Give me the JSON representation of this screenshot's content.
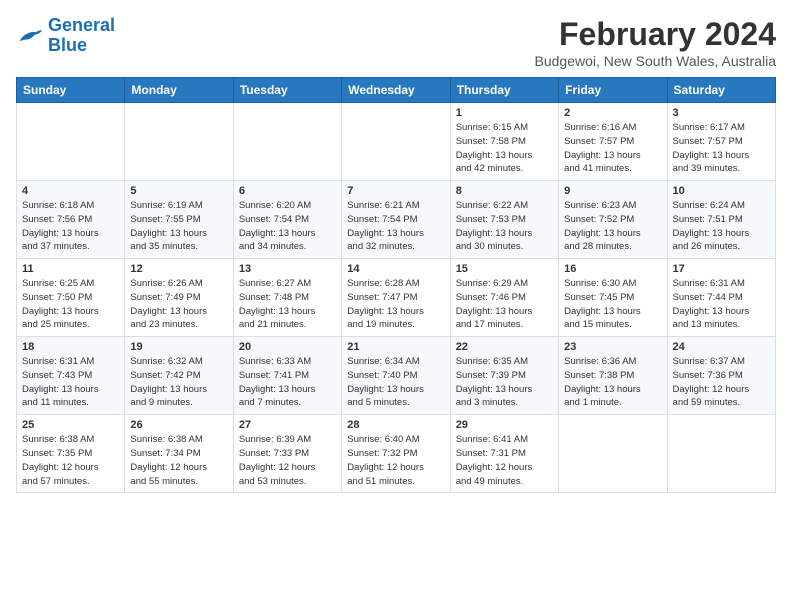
{
  "app": {
    "name_part1": "General",
    "name_part2": "Blue"
  },
  "title": "February 2024",
  "subtitle": "Budgewoi, New South Wales, Australia",
  "headers": [
    "Sunday",
    "Monday",
    "Tuesday",
    "Wednesday",
    "Thursday",
    "Friday",
    "Saturday"
  ],
  "weeks": [
    [
      {
        "day": "",
        "info": ""
      },
      {
        "day": "",
        "info": ""
      },
      {
        "day": "",
        "info": ""
      },
      {
        "day": "",
        "info": ""
      },
      {
        "day": "1",
        "info": "Sunrise: 6:15 AM\nSunset: 7:58 PM\nDaylight: 13 hours\nand 42 minutes."
      },
      {
        "day": "2",
        "info": "Sunrise: 6:16 AM\nSunset: 7:57 PM\nDaylight: 13 hours\nand 41 minutes."
      },
      {
        "day": "3",
        "info": "Sunrise: 6:17 AM\nSunset: 7:57 PM\nDaylight: 13 hours\nand 39 minutes."
      }
    ],
    [
      {
        "day": "4",
        "info": "Sunrise: 6:18 AM\nSunset: 7:56 PM\nDaylight: 13 hours\nand 37 minutes."
      },
      {
        "day": "5",
        "info": "Sunrise: 6:19 AM\nSunset: 7:55 PM\nDaylight: 13 hours\nand 35 minutes."
      },
      {
        "day": "6",
        "info": "Sunrise: 6:20 AM\nSunset: 7:54 PM\nDaylight: 13 hours\nand 34 minutes."
      },
      {
        "day": "7",
        "info": "Sunrise: 6:21 AM\nSunset: 7:54 PM\nDaylight: 13 hours\nand 32 minutes."
      },
      {
        "day": "8",
        "info": "Sunrise: 6:22 AM\nSunset: 7:53 PM\nDaylight: 13 hours\nand 30 minutes."
      },
      {
        "day": "9",
        "info": "Sunrise: 6:23 AM\nSunset: 7:52 PM\nDaylight: 13 hours\nand 28 minutes."
      },
      {
        "day": "10",
        "info": "Sunrise: 6:24 AM\nSunset: 7:51 PM\nDaylight: 13 hours\nand 26 minutes."
      }
    ],
    [
      {
        "day": "11",
        "info": "Sunrise: 6:25 AM\nSunset: 7:50 PM\nDaylight: 13 hours\nand 25 minutes."
      },
      {
        "day": "12",
        "info": "Sunrise: 6:26 AM\nSunset: 7:49 PM\nDaylight: 13 hours\nand 23 minutes."
      },
      {
        "day": "13",
        "info": "Sunrise: 6:27 AM\nSunset: 7:48 PM\nDaylight: 13 hours\nand 21 minutes."
      },
      {
        "day": "14",
        "info": "Sunrise: 6:28 AM\nSunset: 7:47 PM\nDaylight: 13 hours\nand 19 minutes."
      },
      {
        "day": "15",
        "info": "Sunrise: 6:29 AM\nSunset: 7:46 PM\nDaylight: 13 hours\nand 17 minutes."
      },
      {
        "day": "16",
        "info": "Sunrise: 6:30 AM\nSunset: 7:45 PM\nDaylight: 13 hours\nand 15 minutes."
      },
      {
        "day": "17",
        "info": "Sunrise: 6:31 AM\nSunset: 7:44 PM\nDaylight: 13 hours\nand 13 minutes."
      }
    ],
    [
      {
        "day": "18",
        "info": "Sunrise: 6:31 AM\nSunset: 7:43 PM\nDaylight: 13 hours\nand 11 minutes."
      },
      {
        "day": "19",
        "info": "Sunrise: 6:32 AM\nSunset: 7:42 PM\nDaylight: 13 hours\nand 9 minutes."
      },
      {
        "day": "20",
        "info": "Sunrise: 6:33 AM\nSunset: 7:41 PM\nDaylight: 13 hours\nand 7 minutes."
      },
      {
        "day": "21",
        "info": "Sunrise: 6:34 AM\nSunset: 7:40 PM\nDaylight: 13 hours\nand 5 minutes."
      },
      {
        "day": "22",
        "info": "Sunrise: 6:35 AM\nSunset: 7:39 PM\nDaylight: 13 hours\nand 3 minutes."
      },
      {
        "day": "23",
        "info": "Sunrise: 6:36 AM\nSunset: 7:38 PM\nDaylight: 13 hours\nand 1 minute."
      },
      {
        "day": "24",
        "info": "Sunrise: 6:37 AM\nSunset: 7:36 PM\nDaylight: 12 hours\nand 59 minutes."
      }
    ],
    [
      {
        "day": "25",
        "info": "Sunrise: 6:38 AM\nSunset: 7:35 PM\nDaylight: 12 hours\nand 57 minutes."
      },
      {
        "day": "26",
        "info": "Sunrise: 6:38 AM\nSunset: 7:34 PM\nDaylight: 12 hours\nand 55 minutes."
      },
      {
        "day": "27",
        "info": "Sunrise: 6:39 AM\nSunset: 7:33 PM\nDaylight: 12 hours\nand 53 minutes."
      },
      {
        "day": "28",
        "info": "Sunrise: 6:40 AM\nSunset: 7:32 PM\nDaylight: 12 hours\nand 51 minutes."
      },
      {
        "day": "29",
        "info": "Sunrise: 6:41 AM\nSunset: 7:31 PM\nDaylight: 12 hours\nand 49 minutes."
      },
      {
        "day": "",
        "info": ""
      },
      {
        "day": "",
        "info": ""
      }
    ]
  ]
}
